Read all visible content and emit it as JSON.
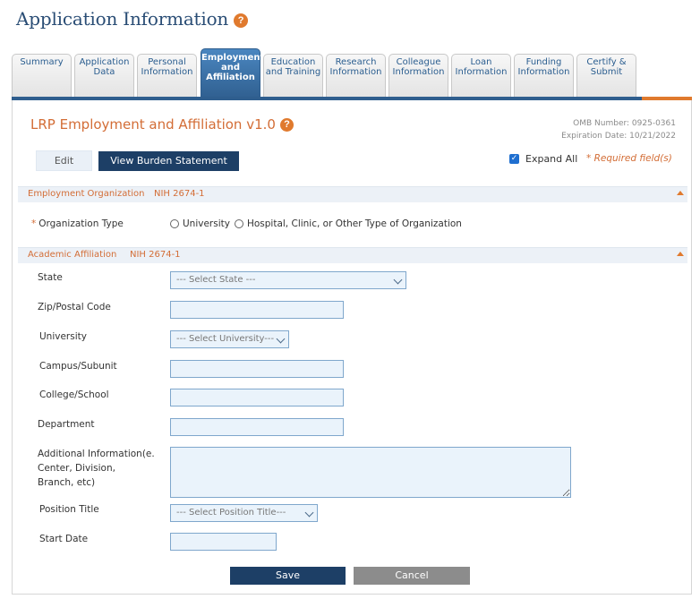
{
  "page": {
    "title": "Application Information",
    "help_icon": "?"
  },
  "tabs": [
    {
      "label_line1": "Summary",
      "label_line2": "",
      "label_line3": "",
      "active": false
    },
    {
      "label_line1": "Application",
      "label_line2": "Data",
      "label_line3": "",
      "active": false
    },
    {
      "label_line1": "Personal",
      "label_line2": "Information",
      "label_line3": "",
      "active": false
    },
    {
      "label_line1": "Employment",
      "label_line2": "and",
      "label_line3": "Affiliation",
      "active": true
    },
    {
      "label_line1": "Education",
      "label_line2": "and Training",
      "label_line3": "",
      "active": false
    },
    {
      "label_line1": "Research",
      "label_line2": "Information",
      "label_line3": "",
      "active": false
    },
    {
      "label_line1": "Colleague",
      "label_line2": "Information",
      "label_line3": "",
      "active": false
    },
    {
      "label_line1": "Loan",
      "label_line2": "Information",
      "label_line3": "",
      "active": false
    },
    {
      "label_line1": "Funding",
      "label_line2": "Information",
      "label_line3": "",
      "active": false
    },
    {
      "label_line1": "Certify &",
      "label_line2": "Submit",
      "label_line3": "",
      "active": false
    }
  ],
  "panel": {
    "title": "LRP Employment and Affiliation v1.0",
    "help_icon": "?",
    "omb_number": "OMB Number: 0925-0361",
    "expiration": "Expiration Date: 10/21/2022",
    "edit_label": "Edit",
    "burden_label": "View Burden Statement",
    "expand_all_label": "Expand All",
    "expand_all_checked": true,
    "checkmark": "✓",
    "required_note": "* Required field(s)"
  },
  "employment_section": {
    "title": "Employment Organization",
    "code": "NIH 2674-1",
    "org_type_star": "*",
    "org_type_label": "Organization Type",
    "options": [
      "University",
      "Hospital, Clinic, or Other Type of Organization"
    ]
  },
  "academic_section": {
    "title": "Academic Affiliation",
    "code": "NIH 2674-1",
    "state_label": "State",
    "state_selected": "--- Select State ---",
    "zip_label": "Zip/Postal Code",
    "zip_value": "",
    "university_label": "University",
    "university_selected": "--- Select University---",
    "campus_label": "Campus/Subunit",
    "campus_value": "",
    "college_label": "College/School",
    "college_value": "",
    "department_label": "Department",
    "department_value": "",
    "additional_label_l1": "Additional Information(e.",
    "additional_label_l2": "Center, Division,",
    "additional_label_l3": "Branch, etc)",
    "additional_value": "",
    "position_label": "Position Title",
    "position_selected": "--- Select Position Title---",
    "start_date_label": "Start Date",
    "start_date_value": ""
  },
  "actions": {
    "save_label": "Save",
    "cancel_label": "Cancel"
  },
  "colors": {
    "title_blue": "#2a4d75",
    "accent_orange": "#d36d36",
    "button_navy": "#1d3f66",
    "active_tab": "#2f5e8e"
  }
}
